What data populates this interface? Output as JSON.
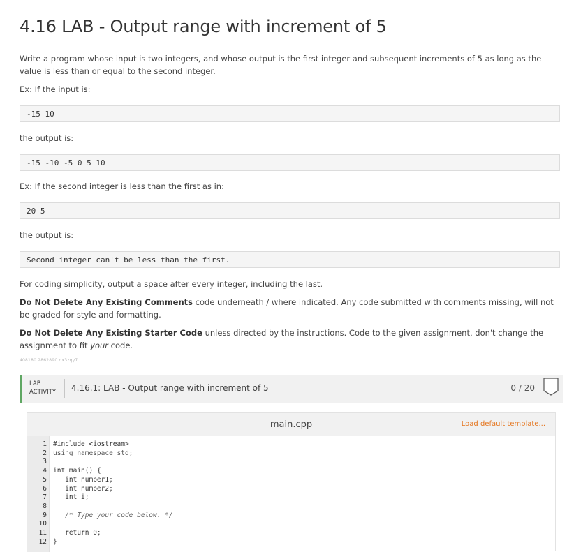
{
  "title": "4.16 LAB - Output range with increment of 5",
  "description": {
    "intro": "Write a program whose input is two integers, and whose output is the first integer and subsequent increments of 5 as long as the value is less than or equal to the second integer.",
    "ex1_label": "Ex: If the input is:",
    "ex1_input": "-15 10",
    "ex1_output_label": "the output is:",
    "ex1_output": "-15 -10 -5 0 5 10",
    "ex2_label": "Ex: If the second integer is less than the first as in:",
    "ex2_input": "20 5",
    "ex2_output_label": "the output is:",
    "ex2_output": "Second integer can't be less than the first.",
    "simplicity_note": "For coding simplicity, output a space after every integer, including the last.",
    "comments_bold": "Do Not Delete Any Existing Comments",
    "comments_rest": " code underneath / where indicated. Any code submitted with comments missing, will not be graded for style and formatting.",
    "starter_bold": "Do Not Delete Any Existing Starter Code",
    "starter_rest_a": " unless directed by the instructions. Code to the given assignment, don't change the assignment to fit ",
    "starter_em": "your",
    "starter_rest_b": " code.",
    "small_id": "408180.2862890.qx3zqy7"
  },
  "lab": {
    "tag_line1": "LAB",
    "tag_line2": "ACTIVITY",
    "name": "4.16.1: LAB - Output range with increment of 5",
    "score": "0 / 20"
  },
  "editor": {
    "file_name": "main.cpp",
    "load_template": "Load default template...",
    "line_numbers": [
      "1",
      "2",
      "3",
      "4",
      "5",
      "6",
      "7",
      "8",
      "9",
      "10",
      "11",
      "12"
    ],
    "lines": [
      "#include <iostream>",
      "using namespace std;",
      "",
      "int main() {",
      "   int number1;",
      "   int number2;",
      "   int i;",
      "",
      "   /* Type your code below. */",
      "",
      "   return 0;",
      "}"
    ]
  }
}
